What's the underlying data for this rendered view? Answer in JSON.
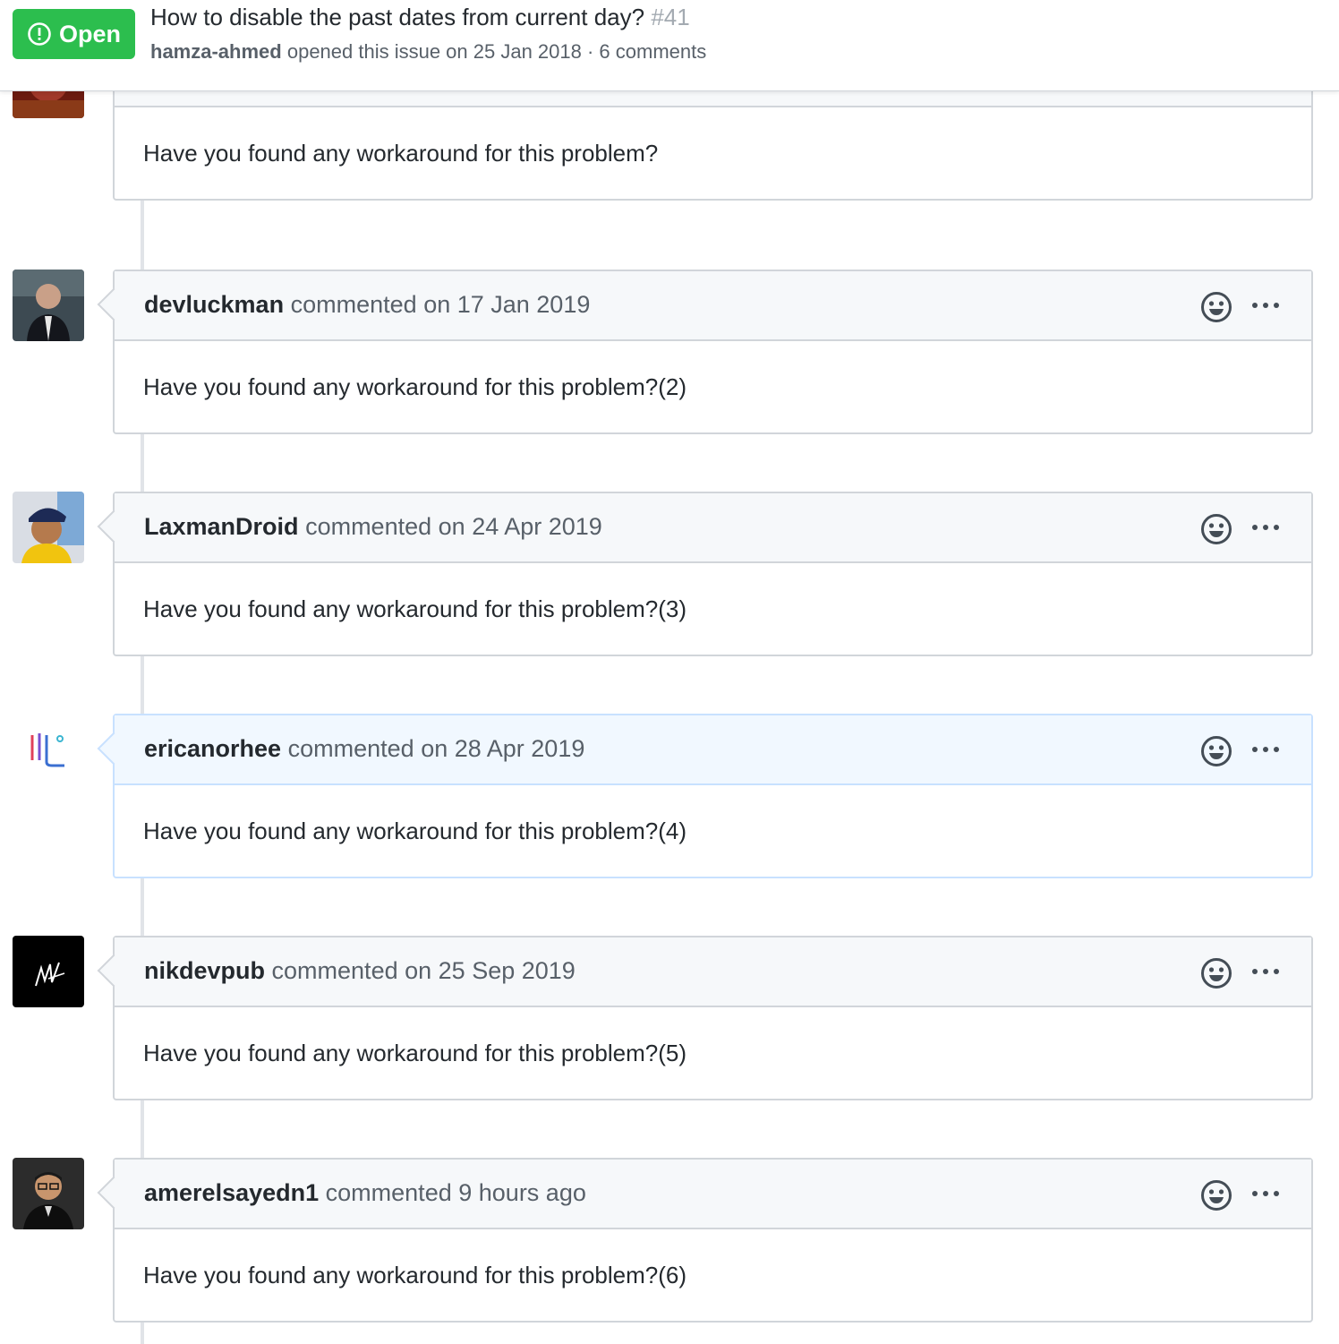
{
  "issue": {
    "state": "Open",
    "title": "How to disable the past dates from current day?",
    "number": "#41",
    "author": "hamza-ahmed",
    "meta": "opened this issue on 25 Jan 2018 · 6 comments"
  },
  "comments": [
    {
      "body": "Have you found any workaround for this problem?"
    },
    {
      "user": "devluckman",
      "action": "commented",
      "time": "on 17 Jan 2019",
      "body": "Have you found any workaround for this problem?(2)"
    },
    {
      "user": "LaxmanDroid",
      "action": "commented",
      "time": "on 24 Apr 2019",
      "body": "Have you found any workaround for this problem?(3)"
    },
    {
      "user": "ericanorhee",
      "action": "commented",
      "time": "on 28 Apr 2019",
      "body": "Have you found any workaround for this problem?(4)"
    },
    {
      "user": "nikdevpub",
      "action": "commented",
      "time": "on 25 Sep 2019",
      "body": "Have you found any workaround for this problem?(5)"
    },
    {
      "user": "amerelsayedn1",
      "action": "commented",
      "time": "9 hours ago",
      "body": "Have you found any workaround for this problem?(6)"
    }
  ],
  "colors": {
    "open_green": "#2cbe4e",
    "highlight_header": "#f1f8ff",
    "header_bg": "#f6f8fa"
  },
  "icons": {
    "state": "issue-opened-icon",
    "reaction": "smiley-icon",
    "menu": "kebab-horizontal-icon"
  }
}
